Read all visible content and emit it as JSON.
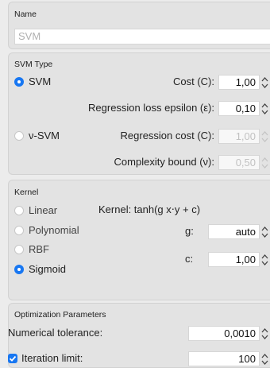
{
  "name_section": {
    "header": "Name",
    "value": "SVM"
  },
  "svm_type": {
    "header": "SVM Type",
    "svm_label": "SVM",
    "cost_label": "Cost (C):",
    "cost_value": "1,00",
    "epsilon_label": "Regression loss epsilon (ε):",
    "epsilon_value": "0,10",
    "nu_label": "ν-SVM",
    "reg_cost_label": "Regression cost (C):",
    "reg_cost_value": "1,00",
    "complexity_label": "Complexity bound (ν):",
    "complexity_value": "0,50"
  },
  "kernel": {
    "header": "Kernel",
    "formula": "Kernel: tanh(g x⋅y + c)",
    "options": [
      "Linear",
      "Polynomial",
      "RBF",
      "Sigmoid"
    ],
    "selected": "Sigmoid",
    "g_label": "g:",
    "g_value": "auto",
    "c_label": "c:",
    "c_value": "1,00"
  },
  "optimization": {
    "header": "Optimization Parameters",
    "tolerance_label": "Numerical tolerance:",
    "tolerance_value": "0,0010",
    "iteration_label": "Iteration limit:",
    "iteration_checked": true,
    "iteration_value": "100"
  },
  "colors": {
    "accent": "#1877f2",
    "panel": "#e3e3e3",
    "background": "#ececec"
  }
}
